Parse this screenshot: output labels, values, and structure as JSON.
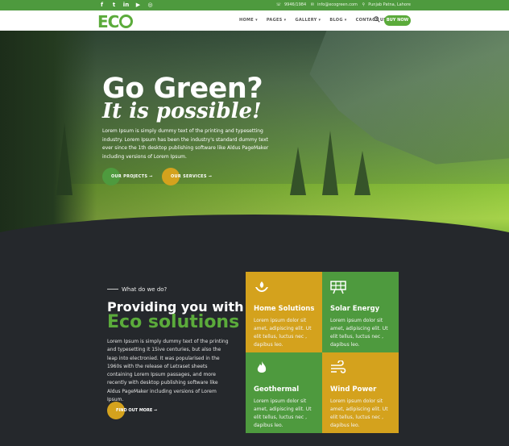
{
  "topbar": {
    "social_icons": [
      "facebook-icon",
      "twitter-icon",
      "linkedin-icon",
      "youtube-icon",
      "dribbble-icon"
    ],
    "phone": "9946/1984",
    "email": "info@ecogreen.com",
    "location": "Punjab Patna, Lahore"
  },
  "navbar": {
    "logo": "ECO",
    "menu": [
      "HOME",
      "PAGES",
      "GALLERY",
      "BLOG",
      "CONTACT US"
    ],
    "buy_label": "BUY NOW"
  },
  "hero": {
    "title": "Go Green?",
    "subtitle": "It is possible!",
    "text": "Lorem Ipsum is simply dummy text of the printing and typesetting industry. Lorem Ipsum has been the industry's standard dummy text ever since the 1th desktop publishing software like Aldus PageMaker including versions of Lorem Ipsum.",
    "btn_projects": "OUR PROJECTS ➞",
    "btn_services": "OUR SERVICES ➞"
  },
  "about": {
    "kicker": "What do we do?",
    "title_line1": "Providing you with",
    "title_line2": "Eco solutions",
    "text": "Lorem Ipsum is simply dummy text of the printing and typesetting it 15ive centuries, but also the leap into electronied. It was popularised in the 1960s with the release of Letraset sheets containing Lorem Ipsum passages, and more recently with desktop publishing software like Aldus PageMaker including versions of Lorem Ipsum.",
    "find_label": "FIND OUT MORE ➞"
  },
  "cards": [
    {
      "title": "Home Solutions",
      "desc": "Lorem ipsum dolor sit amet, adipiscing elit. Ut elit tellus, luctus nec , dapibus leo.",
      "icon": "hands-leaf-icon"
    },
    {
      "title": "Solar Energy",
      "desc": "Lorem ipsum dolor sit amet, adipiscing elit. Ut elit tellus, luctus nec , dapibus leo.",
      "icon": "solar-panel-icon"
    },
    {
      "title": "Geothermal",
      "desc": "Lorem ipsum dolor sit amet, adipiscing elit. Ut elit tellus, luctus nec , dapibus leo.",
      "icon": "flame-icon"
    },
    {
      "title": "Wind Power",
      "desc": "Lorem ipsum dolor sit amet, adipiscing elit. Ut elit tellus, luctus nec , dapibus leo.",
      "icon": "wind-icon"
    }
  ],
  "colors": {
    "green": "#4e9a3e",
    "brand_green": "#5bab3b",
    "yellow": "#d4a21d",
    "dark": "#25282c"
  }
}
